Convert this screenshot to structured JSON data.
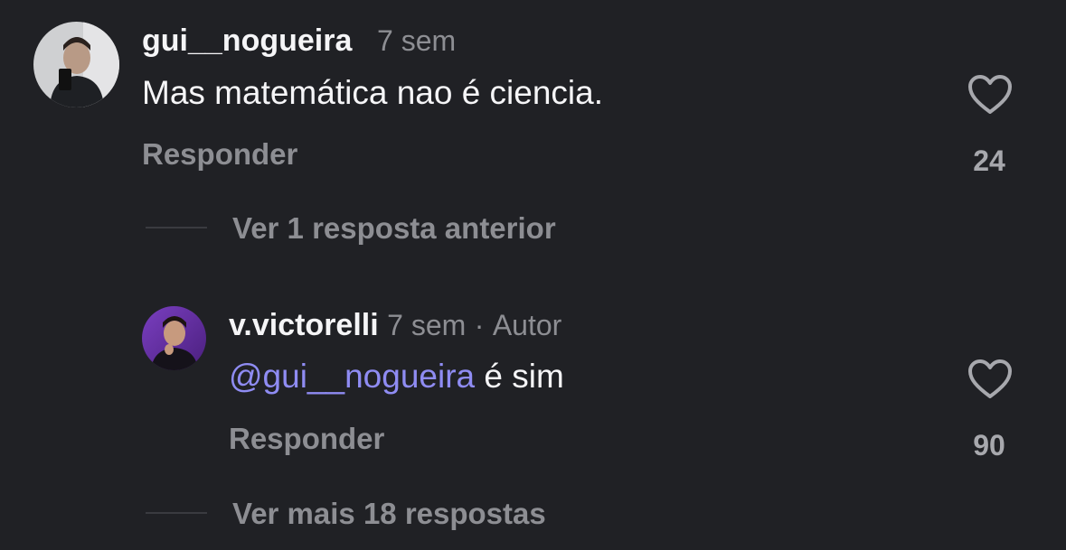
{
  "comments": [
    {
      "username": "gui__nogueira",
      "time": "7 sem",
      "text": "Mas matemática nao é ciencia.",
      "reply_label": "Responder",
      "likes": "24",
      "avatar_icon": "user-avatar-photo"
    }
  ],
  "thread": {
    "view_previous_label": "Ver 1 resposta anterior",
    "view_more_label": "Ver mais 18 respostas"
  },
  "reply": {
    "username": "v.victorelli",
    "time": "7 sem",
    "separator": "·",
    "author_badge": "Autor",
    "mention": "@gui__nogueira",
    "text": " é sim",
    "reply_label": "Responder",
    "likes": "90",
    "avatar_icon": "user-avatar-photo"
  },
  "icons": {
    "like": "heart-outline-icon"
  },
  "colors": {
    "background": "#202125",
    "mention": "#8f8cf3",
    "secondary_text": "#8d8e93"
  }
}
